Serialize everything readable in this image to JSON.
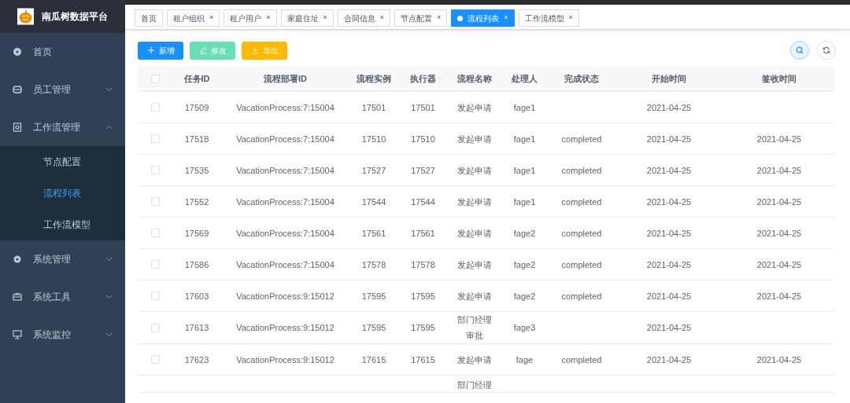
{
  "brand": {
    "title": "南瓜树数据平台"
  },
  "sidebar": {
    "items": [
      {
        "label": "首页",
        "has_children": false
      },
      {
        "label": "员工管理",
        "expanded": false,
        "has_children": true
      },
      {
        "label": "工作流管理",
        "expanded": true,
        "has_children": true,
        "children": [
          {
            "label": "节点配置",
            "selected": false
          },
          {
            "label": "流程列表",
            "selected": true
          },
          {
            "label": "工作流模型",
            "selected": false
          }
        ]
      },
      {
        "label": "系统管理",
        "expanded": false,
        "has_children": true
      },
      {
        "label": "系统工具",
        "expanded": false,
        "has_children": true
      },
      {
        "label": "系统监控",
        "expanded": false,
        "has_children": true
      }
    ]
  },
  "tabs": [
    {
      "label": "首页",
      "selected": false,
      "closable": false
    },
    {
      "label": "租户组织",
      "selected": false,
      "closable": true
    },
    {
      "label": "租户用户",
      "selected": false,
      "closable": true
    },
    {
      "label": "家庭住址",
      "selected": false,
      "closable": true
    },
    {
      "label": "合同信息",
      "selected": false,
      "closable": true
    },
    {
      "label": "节点配置",
      "selected": false,
      "closable": true
    },
    {
      "label": "流程列表",
      "selected": true,
      "closable": true
    },
    {
      "label": "工作流模型",
      "selected": false,
      "closable": true
    }
  ],
  "close_glyph": "×",
  "toolbar": {
    "buttons": [
      {
        "label": "新增",
        "kind": "add"
      },
      {
        "label": "修改",
        "kind": "edit"
      },
      {
        "label": "导出",
        "kind": "export"
      }
    ]
  },
  "table": {
    "all_checked": false,
    "columns": [
      "任务ID",
      "流程部署ID",
      "流程实例",
      "执行器",
      "流程名称",
      "处理人",
      "完成状态",
      "开始时间",
      "签收时间"
    ],
    "rows": [
      {
        "checked": false,
        "cells": [
          "17509",
          "VacationProcess:7:15004",
          "17501",
          "17501",
          "发起申请",
          "fage1",
          "",
          "2021-04-25",
          ""
        ]
      },
      {
        "checked": false,
        "cells": [
          "17518",
          "VacationProcess:7:15004",
          "17510",
          "17510",
          "发起申请",
          "fage1",
          "completed",
          "2021-04-25",
          "2021-04-25"
        ]
      },
      {
        "checked": false,
        "cells": [
          "17535",
          "VacationProcess:7:15004",
          "17527",
          "17527",
          "发起申请",
          "fage1",
          "completed",
          "2021-04-25",
          "2021-04-25"
        ]
      },
      {
        "checked": false,
        "cells": [
          "17552",
          "VacationProcess:7:15004",
          "17544",
          "17544",
          "发起申请",
          "fage1",
          "completed",
          "2021-04-25",
          "2021-04-25"
        ]
      },
      {
        "checked": false,
        "cells": [
          "17569",
          "VacationProcess:7:15004",
          "17561",
          "17561",
          "发起申请",
          "fage2",
          "completed",
          "2021-04-25",
          "2021-04-25"
        ]
      },
      {
        "checked": false,
        "cells": [
          "17586",
          "VacationProcess:7:15004",
          "17578",
          "17578",
          "发起申请",
          "fage2",
          "completed",
          "2021-04-25",
          "2021-04-25"
        ]
      },
      {
        "checked": false,
        "cells": [
          "17603",
          "VacationProcess:9:15012",
          "17595",
          "17595",
          "发起申请",
          "fage2",
          "completed",
          "2021-04-25",
          "2021-04-25"
        ]
      },
      {
        "checked": false,
        "cells": [
          "17613",
          "VacationProcess:9:15012",
          "17595",
          "17595",
          "部门经理审批",
          "fage3",
          "",
          "2021-04-25",
          ""
        ]
      },
      {
        "checked": false,
        "cells": [
          "17623",
          "VacationProcess:9:15012",
          "17615",
          "17615",
          "发起申请",
          "fage",
          "completed",
          "2021-04-25",
          "2021-04-25"
        ]
      },
      {
        "cells": [
          "",
          "",
          "",
          "",
          "部门经理",
          "",
          "",
          "",
          ""
        ]
      }
    ]
  }
}
